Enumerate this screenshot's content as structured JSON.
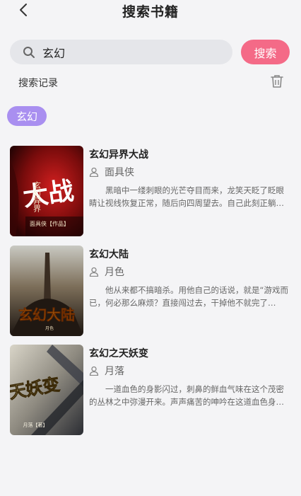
{
  "header": {
    "title": "搜索书籍",
    "back_icon": "chevron-left-icon"
  },
  "search": {
    "value": "玄幻",
    "button_label": "搜索",
    "icon": "search-icon"
  },
  "history": {
    "label": "搜索记录",
    "clear_icon": "trash-icon",
    "tags": [
      "玄幻"
    ]
  },
  "books": [
    {
      "title": "玄幻异界大战",
      "author": "面具侠",
      "description": "黑暗中一缕刺眼的光芒夺目而来，龙笑天眨了眨眼睛让视线恢复正常，随后向四周望去。自己此刻正躺在一张石床上……",
      "cover_text": {
        "big": "大战",
        "small": "玄幻异界",
        "byline": "面具侠【作品】"
      }
    },
    {
      "title": "玄幻大陆",
      "author": "月色",
      "description": "他从来都不搞暗杀。用他自己的话说，就是“游戏而已，何必那么麻烦？直接闯过去，干掉他不就完了嘛。”可……",
      "cover_text": {
        "big": "玄幻大陆",
        "byline": "月色"
      }
    },
    {
      "title": "玄幻之天妖变",
      "author": "月落",
      "description": "一道血色的身影闪过，刺鼻的鲜血气味在这个茂密的丛林之中弥漫开来。声声痛苦的呻吟在这道血色身影闪过之后……",
      "cover_text": {
        "big": "天妖变",
        "byline": "月落【著】"
      }
    }
  ],
  "colors": {
    "accent": "#f46a87",
    "tag": "#a98ff0",
    "background": "#f4f4f6"
  }
}
